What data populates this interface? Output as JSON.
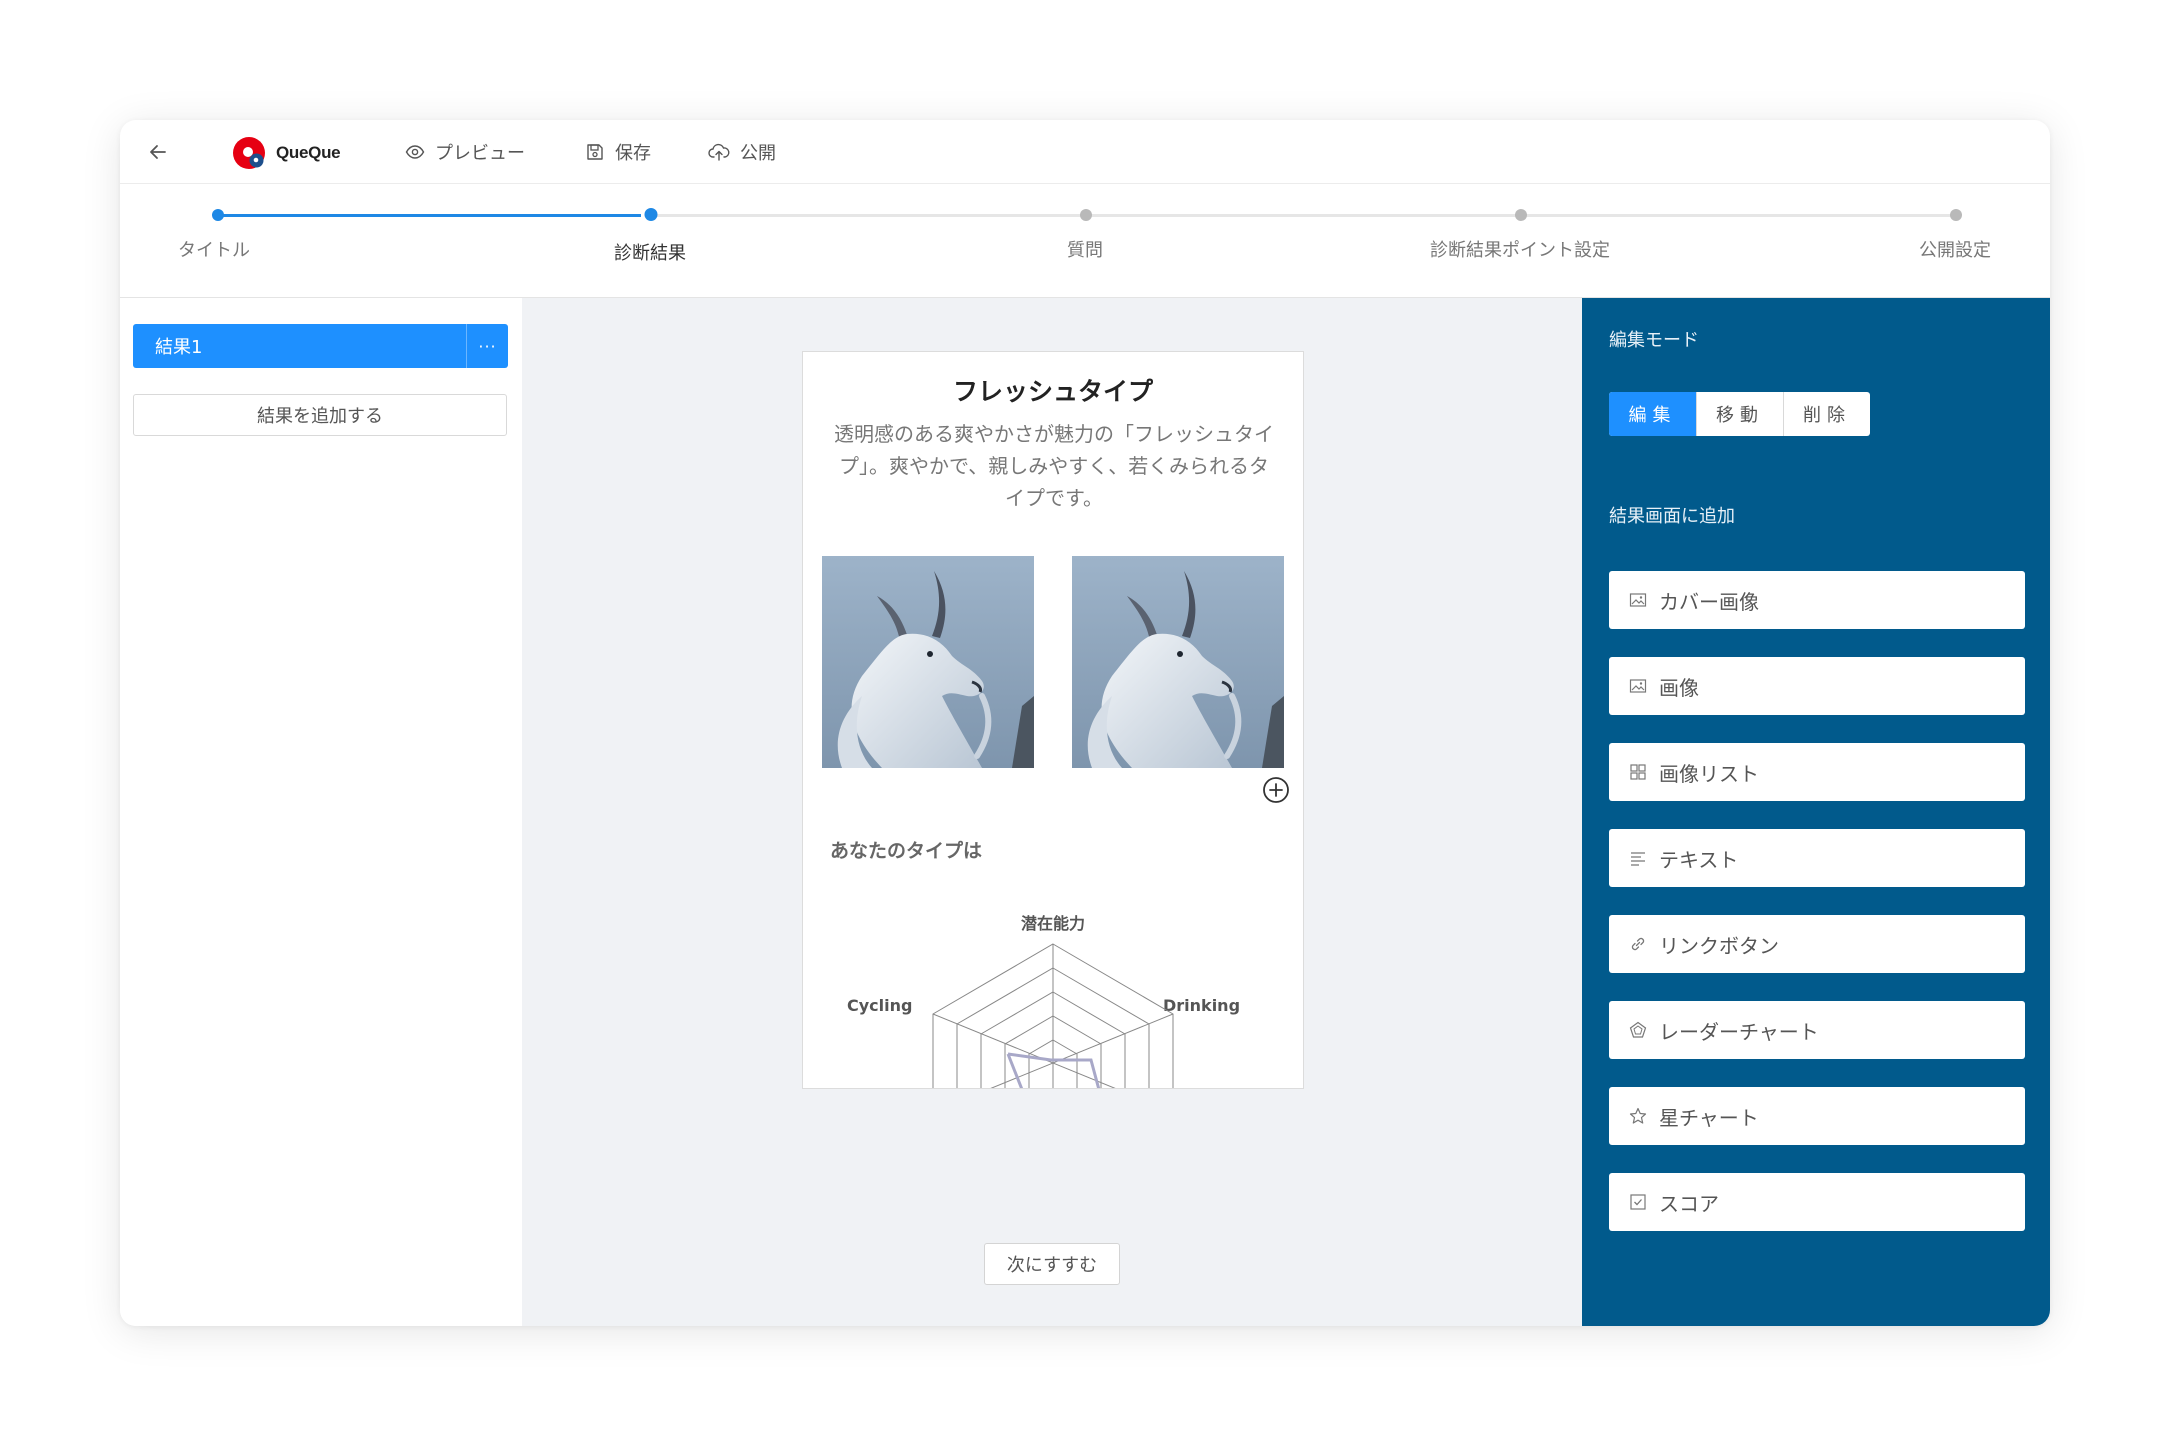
{
  "app": {
    "logo_text": "QueQue",
    "accent_color": "#1e88e5",
    "panel_color": "#015a8c"
  },
  "toolbar": {
    "preview_label": "プレビュー",
    "save_label": "保存",
    "publish_label": "公開"
  },
  "stepper": {
    "steps": [
      {
        "label": "タイトル",
        "state": "done"
      },
      {
        "label": "診断結果",
        "state": "current"
      },
      {
        "label": "質問",
        "state": "todo"
      },
      {
        "label": "診断結果ポイント設定",
        "state": "todo"
      },
      {
        "label": "公開設定",
        "state": "todo"
      }
    ]
  },
  "sidebar": {
    "results": [
      {
        "label": "結果1",
        "more": "···"
      }
    ],
    "add_button_label": "結果を追加する"
  },
  "card": {
    "title": "フレッシュタイプ",
    "description": "透明感のある爽やかさが魅力の「フレッシュタイプ」。爽やかで、親しみやすく、若くみられるタイプです。",
    "type_heading": "あなたのタイプは",
    "radar_labels": {
      "top": "潜在能力",
      "left": "Cycling",
      "right": "Drinking"
    }
  },
  "footer": {
    "next_label": "次にすすむ"
  },
  "right_panel": {
    "mode_title": "編集モード",
    "modes": [
      {
        "label": "編集",
        "active": true
      },
      {
        "label": "移動",
        "active": false
      },
      {
        "label": "削除",
        "active": false
      }
    ],
    "add_title": "結果画面に追加",
    "add_items": [
      {
        "label": "カバー画像",
        "icon": "image-icon"
      },
      {
        "label": "画像",
        "icon": "image-icon"
      },
      {
        "label": "画像リスト",
        "icon": "grid-icon"
      },
      {
        "label": "テキスト",
        "icon": "text-lines-icon"
      },
      {
        "label": "リンクボタン",
        "icon": "link-icon"
      },
      {
        "label": "レーダーチャート",
        "icon": "radar-icon"
      },
      {
        "label": "星チャート",
        "icon": "star-icon"
      },
      {
        "label": "スコア",
        "icon": "checkbox-icon"
      }
    ]
  }
}
